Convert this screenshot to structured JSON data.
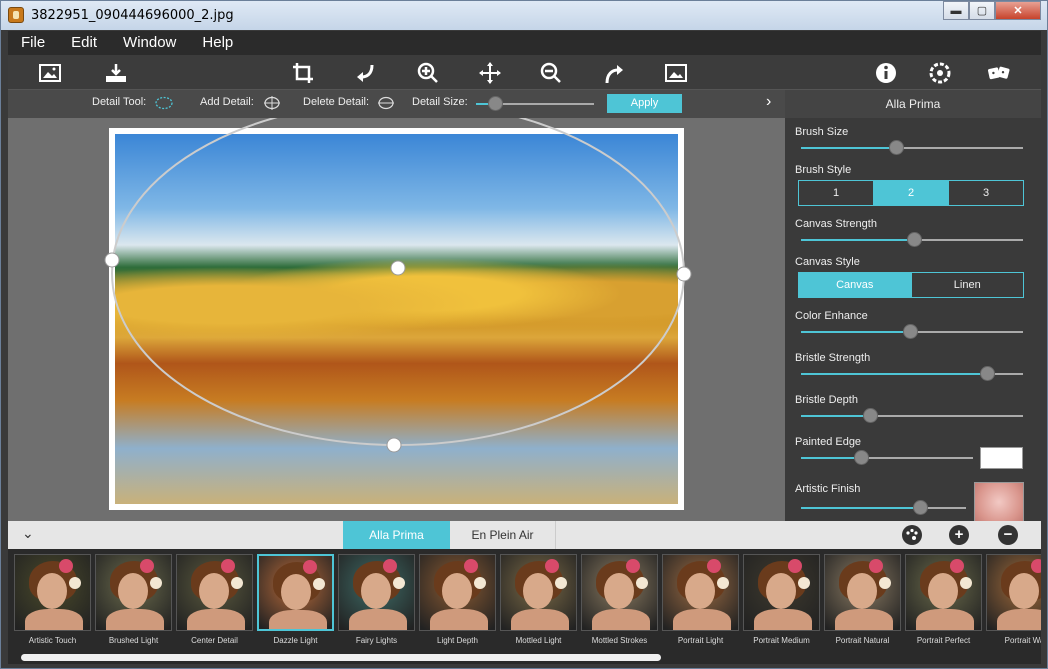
{
  "window": {
    "title": "3822951_090444696000_2.jpg",
    "minimize": "▬",
    "maximize": "▢",
    "close": "✕"
  },
  "menu": [
    "File",
    "Edit",
    "Window",
    "Help"
  ],
  "toolbar_icons": [
    "open-image-icon",
    "save-icon",
    "crop-icon",
    "undo-icon",
    "zoom-in-icon",
    "pan-icon",
    "zoom-out-icon",
    "redo-icon",
    "fit-image-icon",
    "info-icon",
    "settings-icon",
    "random-icon"
  ],
  "detail_bar": {
    "detail_tool_label": "Detail Tool:",
    "add_detail_label": "Add Detail:",
    "delete_detail_label": "Delete Detail:",
    "detail_size_label": "Detail Size:",
    "detail_size_value": 0.16,
    "apply_label": "Apply",
    "expand_glyph": "›"
  },
  "panel": {
    "title": "Alla Prima",
    "controls": [
      {
        "label": "Brush Size",
        "value": 0.43
      },
      {
        "label": "Brush Style",
        "options": [
          "1",
          "2",
          "3"
        ],
        "selected": 1
      },
      {
        "label": "Canvas Strength",
        "value": 0.51
      },
      {
        "label": "Canvas Style",
        "options": [
          "Canvas",
          "Linen"
        ],
        "selected": 0
      },
      {
        "label": "Color Enhance",
        "value": 0.49
      },
      {
        "label": "Bristle Strength",
        "value": 0.84
      },
      {
        "label": "Bristle Depth",
        "value": 0.31
      },
      {
        "label": "Painted Edge",
        "value": 0.35,
        "swatch": "#ffffff"
      },
      {
        "label": "Artistic Finish",
        "value": 0.72
      }
    ]
  },
  "bottom": {
    "collapse_glyph": "⌄",
    "tabs": [
      "Alla Prima",
      "En Plein Air"
    ],
    "active_tab": 0,
    "plus_glyph": "+",
    "minus_glyph": "−"
  },
  "presets": [
    {
      "label": "Artistic Touch",
      "tone": "#4a4a2a"
    },
    {
      "label": "Brushed Light",
      "tone": "#6b6b4c"
    },
    {
      "label": "Center Detail",
      "tone": "#5b5a3e"
    },
    {
      "label": "Dazzle Light",
      "tone": "#b86a3a",
      "selected": true
    },
    {
      "label": "Fairy Lights",
      "tone": "#3e6b66"
    },
    {
      "label": "Light Depth",
      "tone": "#8a5a32"
    },
    {
      "label": "Mottled Light",
      "tone": "#7b6a46"
    },
    {
      "label": "Mottled Strokes",
      "tone": "#8a7a60"
    },
    {
      "label": "Portrait Light",
      "tone": "#9a6a42"
    },
    {
      "label": "Portrait Medium",
      "tone": "#3e3a2e"
    },
    {
      "label": "Portrait Natural",
      "tone": "#8a7a62"
    },
    {
      "label": "Portrait Perfect",
      "tone": "#6a6a4a"
    },
    {
      "label": "Portrait Wa",
      "tone": "#a06a3a"
    }
  ],
  "colors": {
    "accent": "#4ec5d6",
    "panel": "#3a3a3a",
    "canvas_bg": "#6f6f6f"
  }
}
